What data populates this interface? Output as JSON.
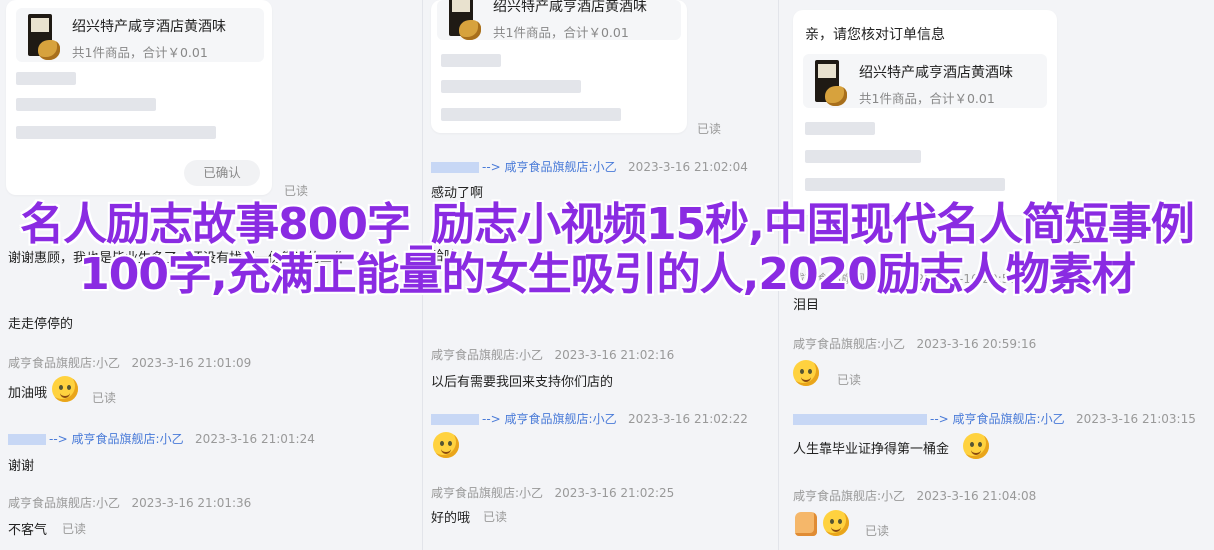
{
  "product": {
    "title": "绍兴特产咸亨酒店黄酒味",
    "subtitle": "共1件商品，合计￥0.01"
  },
  "col1": {
    "confirmed_label": "已确认",
    "read_label": "已读",
    "messages": [
      {
        "text": "谢谢惠顾，我也是毕业生多了，还没有找到一份靠谱的工作"
      },
      {
        "text": "走走停停的"
      },
      {
        "shop": "咸亨食品旗舰店:小乙",
        "time": "2023-3-16 21:01:09",
        "text": "加油哦",
        "read": "已读"
      },
      {
        "shop": "咸亨食品旗舰店:小乙",
        "time": "2023-3-16 21:01:24",
        "text": "谢谢"
      },
      {
        "shop": "咸亨食品旗舰店:小乙",
        "time": "2023-3-16 21:01:36",
        "text": "不客气",
        "read": "已读"
      }
    ],
    "arrow": "-->"
  },
  "col2": {
    "read_label": "已读",
    "arrow": "-->",
    "messages": [
      {
        "shop": "咸亨食品旗舰店:小乙",
        "time": "2023-3-16 21:02:04",
        "text": "感动了啊"
      },
      {
        "text": "哈哈"
      },
      {
        "shop": "咸亨食品旗舰店:小乙",
        "time": "2023-3-16 21:02:16",
        "text": "以后有需要我回来支持你们店的"
      },
      {
        "shop": "咸亨食品旗舰店:小乙",
        "time": "2023-3-16 21:02:22",
        "text": ""
      },
      {
        "shop": "咸亨食品旗舰店:小乙",
        "time": "2023-3-16 21:02:25",
        "text": "好的哦",
        "read": "已读"
      }
    ]
  },
  "col3": {
    "greeting": "亲，请您核对订单信息",
    "read_label": "已读",
    "arrow": "-->",
    "messages": [
      {
        "shop": "咸亨食品旗舰店:小乙",
        "time": "2023-3-16 20:58:54",
        "text": "泪目"
      },
      {
        "shop": "咸亨食品旗舰店:小乙",
        "time": "2023-3-16 20:59:16",
        "read": "已读"
      },
      {
        "shop": "咸亨食品旗舰店:小乙",
        "time": "2023-3-16 21:03:15",
        "text": "人生靠毕业证挣得第一桶金"
      },
      {
        "shop": "咸亨食品旗舰店:小乙",
        "time": "2023-3-16 21:04:08",
        "read": "已读"
      }
    ]
  },
  "headline": "名人励志故事800字_励志小视频15秒,中国现代名人简短事例100字,充满正能量的女生吸引的人,2020励志人物素材"
}
